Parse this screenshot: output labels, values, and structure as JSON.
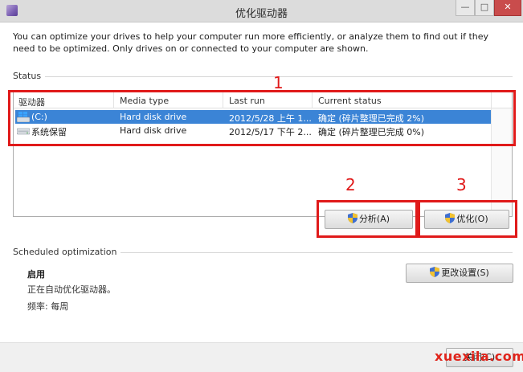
{
  "window": {
    "title": "优化驱动器",
    "minimize": "—",
    "maximize": "□",
    "close": "✕"
  },
  "description": "You can optimize your drives to help your computer run more efficiently, or analyze them to find out if they need to be optimized. Only drives on or connected to your computer are shown.",
  "status": {
    "label": "Status",
    "columns": [
      "驱动器",
      "Media type",
      "Last run",
      "Current status"
    ],
    "rows": [
      {
        "drive": "(C:)",
        "media": "Hard disk drive",
        "last_run": "2012/5/28 上午 1...",
        "status": "确定 (碎片整理已完成 2%)",
        "selected": true,
        "icon": "windows-drive-icon"
      },
      {
        "drive": "系统保留",
        "media": "Hard disk drive",
        "last_run": "2012/5/17 下午 2...",
        "status": "确定 (碎片整理已完成 0%)",
        "selected": false,
        "icon": "hard-drive-icon"
      }
    ]
  },
  "buttons": {
    "analyze": "分析(A)",
    "optimize": "优化(O)",
    "change_settings": "更改设置(S)",
    "close": "关闭(C)"
  },
  "scheduled": {
    "label": "Scheduled optimization",
    "state": "启用",
    "line1": "正在自动优化驱动器。",
    "line2": "频率: 每周"
  },
  "annotations": {
    "n1": "1",
    "n2": "2",
    "n3": "3"
  },
  "watermark": "xuexila.com",
  "colors": {
    "selection": "#3b84d6",
    "annotation_red": "#e01a1a",
    "watermark": "#e0241b"
  }
}
